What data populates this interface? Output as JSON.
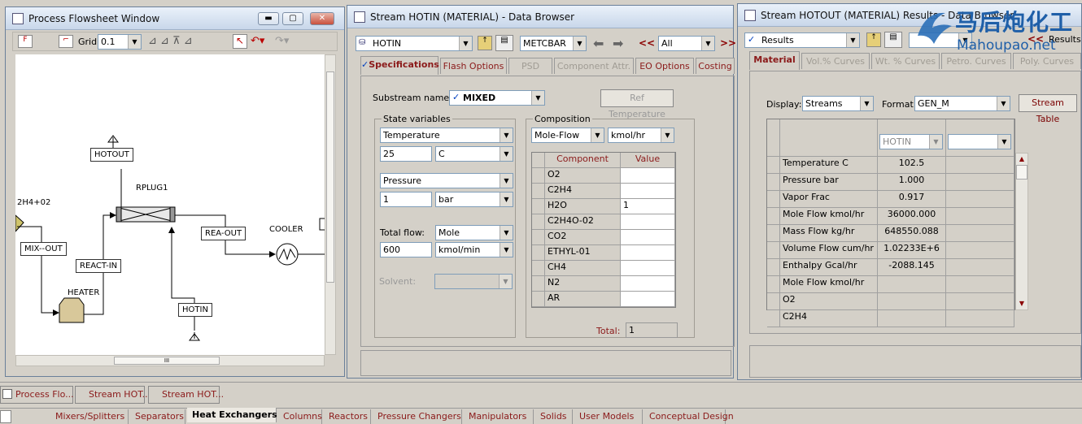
{
  "flowsheet": {
    "title": "Process Flowsheet Window",
    "grid_label": "Grid",
    "grid_value": "0.1",
    "nodes": {
      "hotout": "HOTOUT",
      "rplug": "RPLUG1",
      "feed": "2H4+02",
      "mixout": "MIX--OUT",
      "react_in": "REACT-IN",
      "heater": "HEATER",
      "rea_out": "REA-OUT",
      "cooler": "COOLER",
      "hotin": "HOTIN"
    },
    "scroll_grip": "III"
  },
  "hotin": {
    "title": "Stream HOTIN (MATERIAL) - Data Browser",
    "stream_select": "HOTIN",
    "units_select": "METCBAR",
    "nav_select": "All",
    "nav_back": "<<",
    "nav_fwd": ">>",
    "tabs": [
      "Specifications",
      "Flash Options",
      "PSD",
      "Component Attr.",
      "EO Options",
      "Costing"
    ],
    "substream_label": "Substream name:",
    "substream_value": "MIXED",
    "ref_temp_button": "Ref Temperature",
    "state_vars_label": "State variables",
    "temp_label": "Temperature",
    "temp_value": "25",
    "temp_unit": "C",
    "pressure_label": "Pressure",
    "pressure_value": "1",
    "pressure_unit": "bar",
    "total_flow_label": "Total flow:",
    "flow_basis": "Mole",
    "flow_value": "600",
    "flow_unit": "kmol/min",
    "solvent_label": "Solvent:",
    "composition_label": "Composition",
    "comp_basis": "Mole-Flow",
    "comp_unit": "kmol/hr",
    "comp_headers": [
      "Component",
      "Value"
    ],
    "components": [
      {
        "name": "O2",
        "value": ""
      },
      {
        "name": "C2H4",
        "value": ""
      },
      {
        "name": "H2O",
        "value": "1"
      },
      {
        "name": "C2H4O-02",
        "value": ""
      },
      {
        "name": "CO2",
        "value": ""
      },
      {
        "name": "ETHYL-01",
        "value": ""
      },
      {
        "name": "CH4",
        "value": ""
      },
      {
        "name": "N2",
        "value": ""
      },
      {
        "name": "AR",
        "value": ""
      }
    ],
    "total_label": "Total:",
    "total_value": "1"
  },
  "hotout": {
    "title": "Stream HOTOUT (MATERIAL) Results - Data Browser",
    "results_select": "Results",
    "results_label": "Results",
    "tabs": [
      "Material",
      "Vol.% Curves",
      "Wt. % Curves",
      "Petro. Curves",
      "Poly. Curves"
    ],
    "display_label": "Display:",
    "display_value": "Streams",
    "format_label": "Format:",
    "format_value": "GEN_M",
    "stream_table_button": "Stream Table",
    "column_stream": "HOTIN",
    "rows": [
      {
        "label": "Temperature C",
        "value": "102.5"
      },
      {
        "label": "Pressure bar",
        "value": "1.000"
      },
      {
        "label": "Vapor Frac",
        "value": "0.917"
      },
      {
        "label": "Mole Flow kmol/hr",
        "value": "36000.000"
      },
      {
        "label": "Mass Flow kg/hr",
        "value": "648550.088"
      },
      {
        "label": "Volume Flow cum/hr",
        "value": "1.02233E+6"
      },
      {
        "label": "Enthalpy    Gcal/hr",
        "value": "-2088.145"
      },
      {
        "label": "Mole Flow kmol/hr",
        "value": ""
      },
      {
        "label": "O2",
        "value": ""
      },
      {
        "label": "C2H4",
        "value": ""
      }
    ]
  },
  "watermark": {
    "cn": "马后炮化工",
    "url": "Mahoupao.net"
  },
  "taskbar": {
    "items": [
      "Process Flo...",
      "Stream HOT...",
      "Stream HOT..."
    ]
  },
  "palette": {
    "tabs": [
      "Mixers/Splitters",
      "Separators",
      "Heat Exchangers",
      "Columns",
      "Reactors",
      "Pressure Changers",
      "Manipulators",
      "Solids",
      "User Models",
      "Conceptual Design"
    ],
    "active": "Heat Exchangers"
  }
}
